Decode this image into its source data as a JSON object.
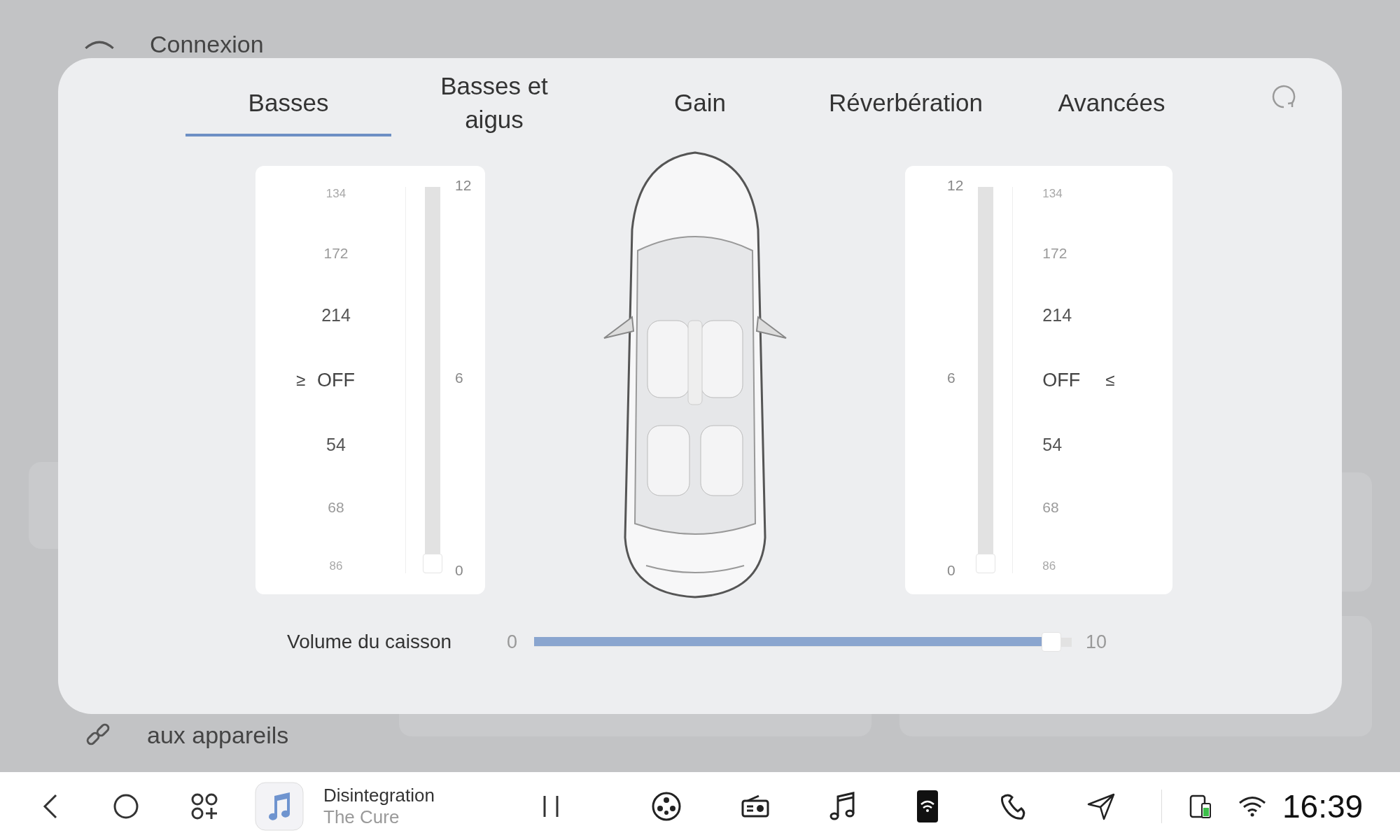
{
  "background": {
    "sections": [
      {
        "label": "Connexion"
      },
      {
        "label": "aux appareils"
      }
    ]
  },
  "dialog": {
    "tabs": [
      {
        "label": "Basses",
        "selected": true
      },
      {
        "label": "Basses et aigus",
        "selected": false
      },
      {
        "label": "Gain",
        "selected": false
      },
      {
        "label": "Réverbération",
        "selected": false
      },
      {
        "label": "Avancées",
        "selected": false
      }
    ],
    "panels": [
      {
        "marker": "≥",
        "picker": [
          {
            "label": "134",
            "selected": false
          },
          {
            "label": "172",
            "selected": false
          },
          {
            "label": "214",
            "selected": false
          },
          {
            "label": "OFF",
            "selected": true
          },
          {
            "label": "54",
            "selected": false
          },
          {
            "label": "68",
            "selected": false
          },
          {
            "label": "86",
            "selected": false
          }
        ],
        "slider": {
          "level": 0,
          "ticks": [
            "12",
            "6",
            "0"
          ]
        }
      },
      {
        "marker": "≤",
        "picker": [
          {
            "label": "134",
            "selected": false
          },
          {
            "label": "172",
            "selected": false
          },
          {
            "label": "214",
            "selected": false
          },
          {
            "label": "OFF",
            "selected": true
          },
          {
            "label": "54",
            "selected": false
          },
          {
            "label": "68",
            "selected": false
          },
          {
            "label": "86",
            "selected": false
          }
        ],
        "slider": {
          "level": 0,
          "ticks": [
            "12",
            "6",
            "0"
          ]
        }
      }
    ],
    "subwoofer": {
      "label": "Volume du caisson",
      "min": "0",
      "max": "10",
      "level": 0.98
    }
  },
  "taskbar": {
    "track": {
      "title": "Disintegration",
      "artist": "The Cure",
      "playing": true
    },
    "time": "16:39"
  }
}
